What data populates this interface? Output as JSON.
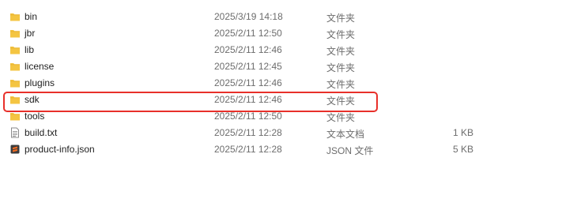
{
  "files": [
    {
      "name": "bin",
      "date": "2025/3/19 14:18",
      "type": "文件夹",
      "size": "",
      "icon": "folder-icon"
    },
    {
      "name": "jbr",
      "date": "2025/2/11 12:50",
      "type": "文件夹",
      "size": "",
      "icon": "folder-icon"
    },
    {
      "name": "lib",
      "date": "2025/2/11 12:46",
      "type": "文件夹",
      "size": "",
      "icon": "folder-icon"
    },
    {
      "name": "license",
      "date": "2025/2/11 12:45",
      "type": "文件夹",
      "size": "",
      "icon": "folder-icon"
    },
    {
      "name": "plugins",
      "date": "2025/2/11 12:46",
      "type": "文件夹",
      "size": "",
      "icon": "folder-icon"
    },
    {
      "name": "sdk",
      "date": "2025/2/11 12:46",
      "type": "文件夹",
      "size": "",
      "icon": "folder-icon"
    },
    {
      "name": "tools",
      "date": "2025/2/11 12:50",
      "type": "文件夹",
      "size": "",
      "icon": "folder-icon"
    },
    {
      "name": "build.txt",
      "date": "2025/2/11 12:28",
      "type": "文本文档",
      "size": "1 KB",
      "icon": "text-file-icon"
    },
    {
      "name": "product-info.json",
      "date": "2025/2/11 12:28",
      "type": "JSON 文件",
      "size": "5 KB",
      "icon": "json-file-icon"
    }
  ],
  "highlight": {
    "color": "#e8302a",
    "row": "sdk"
  },
  "colors": {
    "folder": "#f4c542",
    "folder_dark": "#e0a82a",
    "json_icon": "#f26b21"
  }
}
